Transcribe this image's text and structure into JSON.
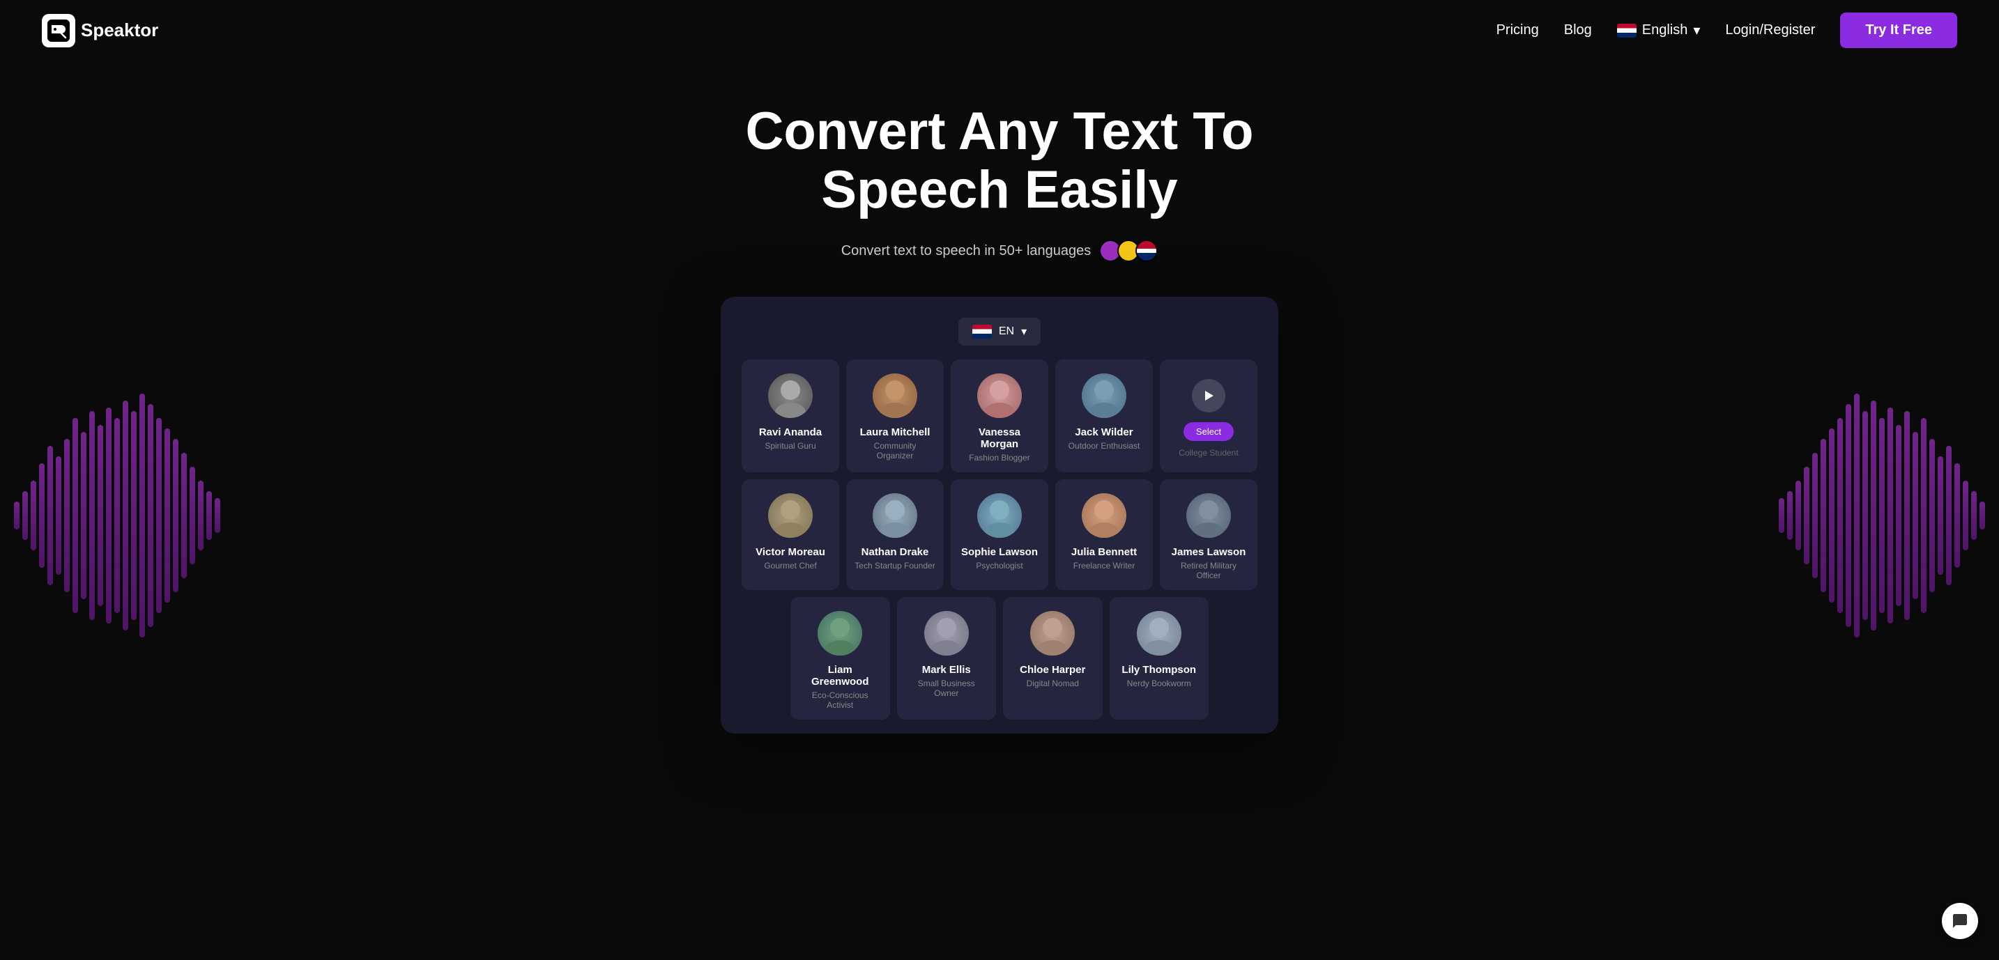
{
  "header": {
    "logo_text": "Speaktor",
    "nav": {
      "pricing": "Pricing",
      "blog": "Blog",
      "language": "English",
      "login": "Login/Register",
      "try_btn": "Try It Free"
    }
  },
  "hero": {
    "title": "Convert Any Text To Speech Easily",
    "subtitle": "Convert text to speech in 50+ languages"
  },
  "app": {
    "lang_selector": "EN",
    "voices_row1": [
      {
        "name": "Ravi Ananda",
        "title": "Spiritual Guru",
        "av_class": "av-ravi",
        "emoji": "👴"
      },
      {
        "name": "Laura Mitchell",
        "title": "Community Organizer",
        "av_class": "av-laura",
        "emoji": "👩"
      },
      {
        "name": "Vanessa Morgan",
        "title": "Fashion Blogger",
        "av_class": "av-vanessa",
        "emoji": "👩"
      },
      {
        "name": "Jack Wilder",
        "title": "Outdoor Enthusiast",
        "av_class": "av-jack",
        "emoji": "👨"
      },
      {
        "name": "Select",
        "title": "College Student",
        "av_class": "select",
        "emoji": "▶"
      }
    ],
    "voices_row2": [
      {
        "name": "Victor Moreau",
        "title": "Gourmet Chef",
        "av_class": "av-victor",
        "emoji": "👨"
      },
      {
        "name": "Nathan Drake",
        "title": "Tech Startup Founder",
        "av_class": "av-nathan",
        "emoji": "👨"
      },
      {
        "name": "Sophie Lawson",
        "title": "Psychologist",
        "av_class": "av-sophie",
        "emoji": "👩"
      },
      {
        "name": "Julia Bennett",
        "title": "Freelance Writer",
        "av_class": "av-julia",
        "emoji": "👩"
      },
      {
        "name": "James Lawson",
        "title": "Retired Military Officer",
        "av_class": "av-james",
        "emoji": "👨"
      }
    ],
    "voices_row3": [
      {
        "name": "Liam Greenwood",
        "title": "Eco-Conscious Activist",
        "av_class": "av-liam",
        "emoji": "👨"
      },
      {
        "name": "Mark Ellis",
        "title": "Small Business Owner",
        "av_class": "av-mark",
        "emoji": "👨"
      },
      {
        "name": "Chloe Harper",
        "title": "Digital Nomad",
        "av_class": "av-chloe",
        "emoji": "👩"
      },
      {
        "name": "Lily Thompson",
        "title": "Nerdy Bookworm",
        "av_class": "av-lily",
        "emoji": "👩"
      }
    ],
    "select_label": "Select",
    "select_subtext": "College Student"
  },
  "chat_icon": "💬"
}
